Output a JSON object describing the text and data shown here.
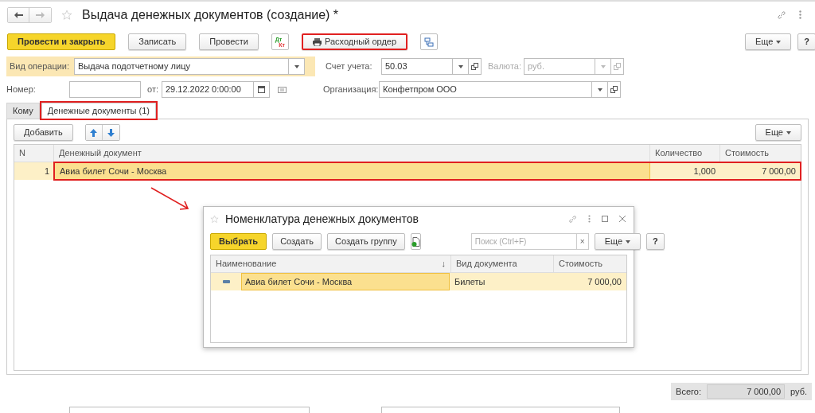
{
  "window": {
    "title": "Выдача денежных документов (создание) *"
  },
  "toolbar": {
    "buttons": [
      {
        "label": "Провести и закрыть",
        "kind": "primary",
        "highlighted": false
      },
      {
        "label": "Записать",
        "kind": "plain",
        "highlighted": false
      },
      {
        "label": "Провести",
        "kind": "plain",
        "highlighted": false
      },
      {
        "kind": "dtkt",
        "dt": "Дт",
        "kt": "Кт",
        "highlighted": false
      },
      {
        "label": "Расходный ордер",
        "kind": "print",
        "highlighted": true
      },
      {
        "kind": "structure",
        "highlighted": false
      }
    ],
    "more": "Еще",
    "help": "?"
  },
  "fields": {
    "operation": {
      "label": "Вид операции:",
      "value": "Выдача подотчетному лицу"
    },
    "account": {
      "label": "Счет учета:",
      "value": "50.03"
    },
    "currency": {
      "label": "Валюта:",
      "value": "руб.",
      "disabled": true
    },
    "number": {
      "label": "Номер:"
    },
    "date": {
      "label": "от:",
      "value": "29.12.2022  0:00:00"
    },
    "organization": {
      "label": "Организация:",
      "value": "Конфетпром ООО"
    }
  },
  "tabs": [
    {
      "label": "Кому",
      "selected": false,
      "highlighted": false
    },
    {
      "label": "Денежные документы (1)",
      "selected": true,
      "highlighted": true
    }
  ],
  "table": {
    "add": "Добавить",
    "more": "Еще",
    "columns": [
      "N",
      "Денежный документ",
      "Количество",
      "Стоимость"
    ],
    "rows": [
      {
        "cells": [
          "1",
          "Авиа билет Сочи - Москва",
          "1,000",
          "7 000,00"
        ],
        "selected": true,
        "highlighted": true
      }
    ]
  },
  "dialog": {
    "title": "Номенклатура денежных документов",
    "buttons": [
      {
        "label": "Выбрать",
        "kind": "primary"
      },
      {
        "label": "Создать",
        "kind": "plain"
      },
      {
        "label": "Создать группу",
        "kind": "plain"
      },
      {
        "kind": "add-copy"
      }
    ],
    "search": {
      "placeholder": "Поиск (Ctrl+F)",
      "clear": "×"
    },
    "more": "Еще",
    "help": "?",
    "columns": [
      "Наименование",
      "Вид документа",
      "Стоимость"
    ],
    "sort_mark": "↓",
    "rows": [
      {
        "cells": [
          "Авиа билет Сочи - Москва",
          "Билеты",
          "7 000,00"
        ],
        "selected": true
      }
    ]
  },
  "total": {
    "label": "Всего:",
    "value": "7 000,00",
    "unit": "руб."
  }
}
